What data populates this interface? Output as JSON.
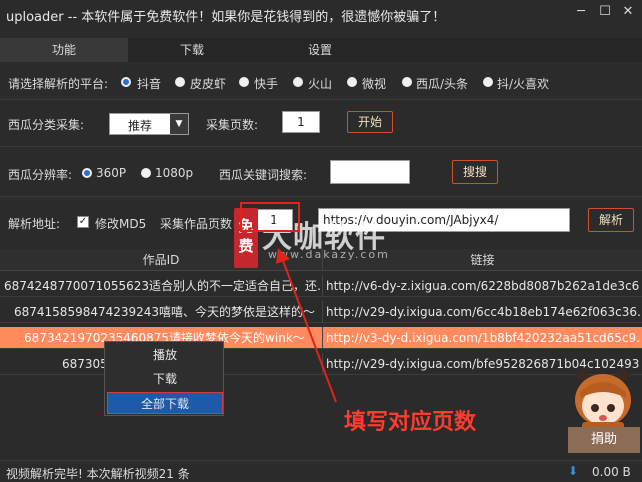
{
  "window": {
    "title": "uploader -- 本软件属于免费软件！如果你是花钱得到的，很遗憾你被骗了！",
    "controls": [
      "minimize",
      "maximize",
      "close"
    ]
  },
  "tabs": [
    {
      "label": "功能",
      "active": true
    },
    {
      "label": "下载",
      "active": false
    },
    {
      "label": "设置",
      "active": false
    }
  ],
  "platform": {
    "label": "请选择解析的平台:",
    "options": [
      {
        "label": "抖音",
        "selected": true
      },
      {
        "label": "皮皮虾",
        "selected": false
      },
      {
        "label": "快手",
        "selected": false
      },
      {
        "label": "火山",
        "selected": false
      },
      {
        "label": "微视",
        "selected": false
      },
      {
        "label": "西瓜/头条",
        "selected": false
      },
      {
        "label": "抖/火喜欢",
        "selected": false
      }
    ]
  },
  "xigua_collect": {
    "label": "西瓜分类采集:",
    "category_value": "推荐",
    "pages_label": "采集页数:",
    "pages_value": "1",
    "start_label": "开始"
  },
  "resolution": {
    "label": "西瓜分辨率:",
    "options": [
      {
        "label": "360P",
        "selected": true
      },
      {
        "label": "1080p",
        "selected": false
      }
    ],
    "keyword_label": "西瓜关键词搜索:",
    "keyword_value": "",
    "search_label": "搜搜"
  },
  "parse": {
    "label": "解析地址:",
    "md5_label": "修改MD5",
    "md5_checked": true,
    "pages_label": "采集作品页数",
    "pages_value": "1",
    "url_value": "https://v.douyin.com/JAbjyx4/",
    "parse_label": "解析"
  },
  "table": {
    "columns": [
      "作品ID",
      "链接"
    ],
    "rows": [
      {
        "id": "6874248770071055623适合别人的不一定适合自己，还…",
        "link": "http://v6-dy-z.ixigua.com/6228bd8087b262a1de3c6…",
        "selected": false
      },
      {
        "id": "6874158598474239243嘻嘻、今天的梦依是这样的～",
        "link": "http://v29-dy.ixigua.com/6cc4b18eb174e62f063c36…",
        "selected": false
      },
      {
        "id": "6873421970235460875请接收梦依今天的wink～",
        "link": "http://v3-dy-d.ixigua.com/1b8bf420232aa51cd65c9…",
        "selected": true
      },
      {
        "id": "687305…敷衍～",
        "link": "http://v29-dy.ixigua.com/bfe952826871b04c102493…",
        "selected": false
      }
    ]
  },
  "context_menu": {
    "items": [
      {
        "label": "播放",
        "highlighted": false
      },
      {
        "label": "下载",
        "highlighted": false
      },
      {
        "label": "全部下载",
        "highlighted": true
      }
    ]
  },
  "status": {
    "text": "视频解析完毕! 本次解析视频21 条",
    "speed": "0.00 B"
  },
  "watermark": {
    "seal": "免费",
    "site_name": "大咖软件",
    "site_url": "www.dakazy.com"
  },
  "annotation": {
    "text": "填写对应页数"
  },
  "donate": {
    "label": "捐助"
  },
  "colors": {
    "background": "#2b2b2b",
    "accent_border": "#d0512a",
    "selected_row": "#ff8a5e",
    "menu_highlight": "#1f5aa8",
    "annotation": "#ff3b2f"
  }
}
